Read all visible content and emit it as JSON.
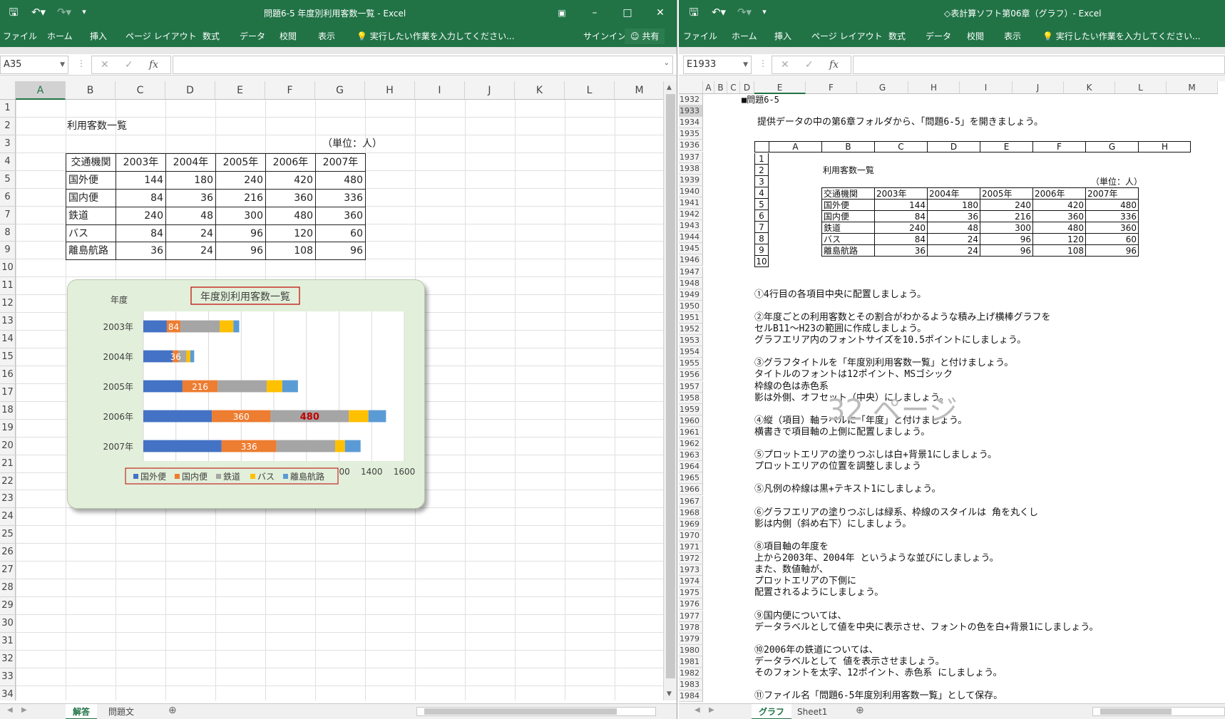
{
  "left": {
    "title": "問題6-5 年度別利用客数一覧 - Excel",
    "tabs": [
      "ファイル",
      "ホーム",
      "挿入",
      "ページ レイアウト",
      "数式",
      "データ",
      "校閲",
      "表示"
    ],
    "tell_me": "実行したい作業を入力してください...",
    "signin": "サインイン",
    "share": "共有",
    "name_box": "A35",
    "columns": [
      "A",
      "B",
      "C",
      "D",
      "E",
      "F",
      "G",
      "H",
      "I",
      "J",
      "K",
      "L",
      "M"
    ],
    "rows": [
      "1",
      "2",
      "3",
      "4",
      "5",
      "6",
      "7",
      "8",
      "9",
      "10",
      "11",
      "12",
      "13",
      "14",
      "15",
      "16",
      "17",
      "18",
      "19",
      "20",
      "21",
      "22",
      "23",
      "24",
      "25",
      "26",
      "27",
      "28",
      "29",
      "30",
      "31",
      "32",
      "33",
      "34"
    ],
    "sheet_title": "利用客数一覧",
    "unit": "（単位：人）",
    "table_header": [
      "交通機関",
      "2003年",
      "2004年",
      "2005年",
      "2006年",
      "2007年"
    ],
    "table_rows": [
      [
        "国外便",
        "144",
        "180",
        "240",
        "420",
        "480"
      ],
      [
        "国内便",
        "84",
        "36",
        "216",
        "360",
        "336"
      ],
      [
        "鉄道",
        "240",
        "48",
        "300",
        "480",
        "360"
      ],
      [
        "バス",
        "84",
        "24",
        "96",
        "120",
        "60"
      ],
      [
        "離島航路",
        "36",
        "24",
        "96",
        "108",
        "96"
      ]
    ],
    "sheet_tabs": [
      "解答",
      "問題文"
    ],
    "active_sheet": "解答"
  },
  "chart_data": {
    "type": "bar",
    "orientation": "horizontal",
    "stacked": true,
    "title": "年度別利用客数一覧",
    "ylabel": "年度",
    "categories": [
      "2003年",
      "2004年",
      "2005年",
      "2006年",
      "2007年"
    ],
    "series": [
      {
        "name": "国外便",
        "color": "#4472c4",
        "values": [
          144,
          180,
          240,
          420,
          480
        ]
      },
      {
        "name": "国内便",
        "color": "#ed7d31",
        "values": [
          84,
          36,
          216,
          360,
          336
        ]
      },
      {
        "name": "鉄道",
        "color": "#a5a5a5",
        "values": [
          240,
          48,
          300,
          480,
          360
        ]
      },
      {
        "name": "バス",
        "color": "#ffc000",
        "values": [
          84,
          24,
          96,
          120,
          60
        ]
      },
      {
        "name": "離島航路",
        "color": "#5b9bd5",
        "values": [
          36,
          24,
          96,
          108,
          96
        ]
      }
    ],
    "data_labels": [
      {
        "series": 1,
        "category": 0,
        "text": "84",
        "color": "#ffffff"
      },
      {
        "series": 1,
        "category": 1,
        "text": "36",
        "color": "#ffffff"
      },
      {
        "series": 1,
        "category": 2,
        "text": "216",
        "color": "#ffffff"
      },
      {
        "series": 1,
        "category": 3,
        "text": "360",
        "color": "#ffffff"
      },
      {
        "series": 1,
        "category": 4,
        "text": "336",
        "color": "#ffffff"
      },
      {
        "series": 2,
        "category": 3,
        "text": "480",
        "color": "#c00000"
      }
    ],
    "xlim": [
      0,
      1600
    ],
    "xticks": [
      "0",
      "200",
      "400",
      "600",
      "800",
      "1000",
      "1200",
      "1400",
      "1600"
    ],
    "grid": true,
    "legend": "bottom"
  },
  "right": {
    "title": "◇表計算ソフト第06章（グラフ）- Excel",
    "tabs": [
      "ファイル",
      "ホーム",
      "挿入",
      "ページ レイアウト",
      "数式",
      "データ",
      "校閲",
      "表示"
    ],
    "tell_me": "実行したい作業を入力してください...",
    "name_box": "E1933",
    "columns": [
      "A",
      "B",
      "C",
      "D",
      "E",
      "F",
      "G",
      "H",
      "I",
      "J",
      "K",
      "L",
      "M"
    ],
    "rows": [
      "1932",
      "1933",
      "1934",
      "1935",
      "1936",
      "1937",
      "1938",
      "1939",
      "1940",
      "1941",
      "1942",
      "1943",
      "1944",
      "1945",
      "1946",
      "1947",
      "1948",
      "1949",
      "1950",
      "1951",
      "1952",
      "1953",
      "1954",
      "1955",
      "1956",
      "1957",
      "1958",
      "1959",
      "1960",
      "1961",
      "1962",
      "1963",
      "1964",
      "1965",
      "1966",
      "1967",
      "1968",
      "1969",
      "1970",
      "1971",
      "1972",
      "1973",
      "1974",
      "1975",
      "1976",
      "1977",
      "1978",
      "1979",
      "1980",
      "1981",
      "1982",
      "1983",
      "1984"
    ],
    "heading": "■問題6-5",
    "intro": "提供データの中の第6章フォルダから、「問題6-5」を開きましょう。",
    "emb_cols": [
      "A",
      "B",
      "C",
      "D",
      "E",
      "F",
      "G",
      "H"
    ],
    "emb_rows": [
      "1",
      "2",
      "3",
      "4",
      "5",
      "6",
      "7",
      "8",
      "9",
      "10"
    ],
    "emb_title": "利用客数一覧",
    "emb_unit": "（単位：人）",
    "instructions": [
      {
        "row": 17,
        "text": "①4行目の各項目中央に配置しましょう。"
      },
      {
        "row": 19,
        "text": "②年度ごとの利用客数とその割合がわかるような積み上げ横棒グラフを"
      },
      {
        "row": 20,
        "text": "セルB11～H23の範囲に作成しましょう。"
      },
      {
        "row": 21,
        "text": "グラフエリア内のフォントサイズを10.5ポイントにしましょう。"
      },
      {
        "row": 23,
        "text": "③グラフタイトルを「年度別利用客数一覧」と付けましょう。"
      },
      {
        "row": 24,
        "text": "タイトルのフォントは12ポイント、MSゴシック"
      },
      {
        "row": 25,
        "text": "枠線の色は赤色系"
      },
      {
        "row": 26,
        "text": "影は外側、オフセット（中央）にしましょう。"
      },
      {
        "row": 28,
        "text": "④縦（項目）軸ラベルに「年度」と付けましょう。"
      },
      {
        "row": 29,
        "text": "横書きで項目軸の上側に配置しましょう。"
      },
      {
        "row": 31,
        "text": "⑤プロットエリアの塗りつぶしは白+背景1にしましょう。"
      },
      {
        "row": 32,
        "text": "プロットエリアの位置を調整しましょう"
      },
      {
        "row": 34,
        "text": "⑤凡例の枠線は黒+テキスト1にしましょう。"
      },
      {
        "row": 36,
        "text": "⑥グラフエリアの塗りつぶしは緑系、枠線のスタイルは 角を丸くし"
      },
      {
        "row": 37,
        "text": "影は内側（斜め右下）にしましょう。"
      },
      {
        "row": 39,
        "text": "⑧項目軸の年度を"
      },
      {
        "row": 40,
        "text": "上から2003年、2004年 というような並びにしましょう。"
      },
      {
        "row": 41,
        "text": "また、数値軸が、"
      },
      {
        "row": 42,
        "text": "プロットエリアの下側に"
      },
      {
        "row": 43,
        "text": "配置されるようにしましょう。"
      },
      {
        "row": 45,
        "text": "⑨国内便については、"
      },
      {
        "row": 46,
        "text": "データラベルとして値を中央に表示させ、フォントの色を白+背景1にしましょう。"
      },
      {
        "row": 48,
        "text": "⑩2006年の鉄道については、"
      },
      {
        "row": 49,
        "text": "データラベルとして 値を表示させましょう。"
      },
      {
        "row": 50,
        "text": "そのフォントを太字、12ポイント、赤色系 にしましょう。"
      },
      {
        "row": 52,
        "text": "⑪ファイル名「問題6-5年度別利用客数一覧」として保存。"
      }
    ],
    "watermark": "32 ページ",
    "sheet_tabs": [
      "グラフ",
      "Sheet1"
    ],
    "active_sheet": "グラフ"
  }
}
